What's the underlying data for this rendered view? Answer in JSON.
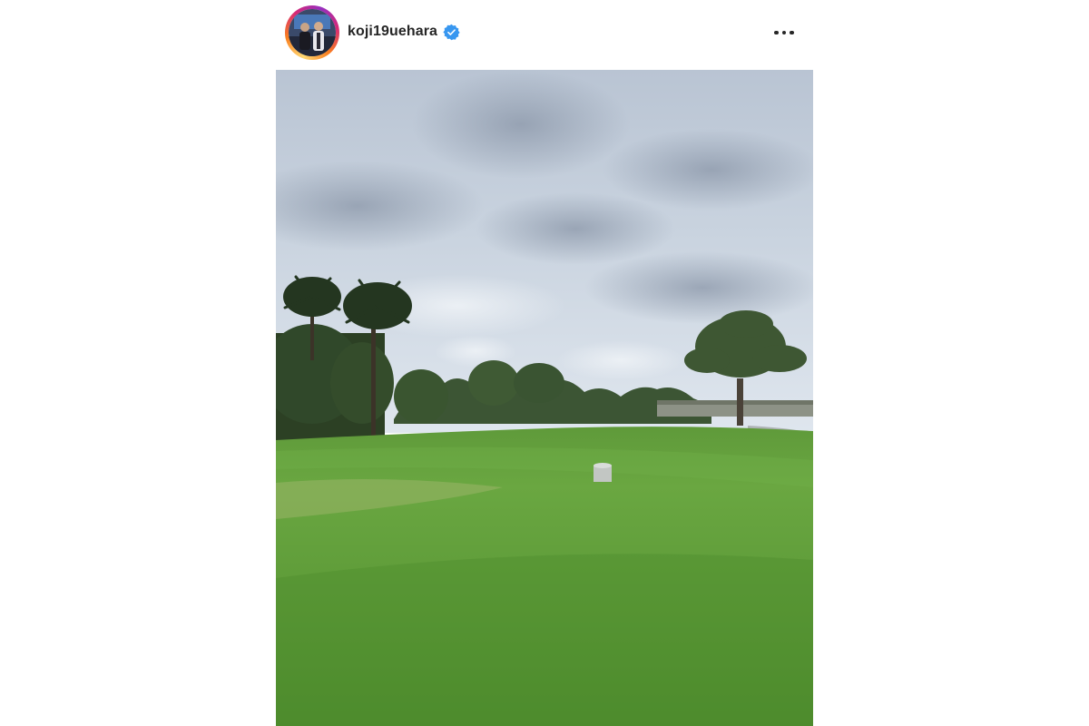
{
  "post": {
    "username": "koji19uehara",
    "verified": true,
    "avatar_icon": "profile-avatar",
    "verified_icon": "verified-badge-icon",
    "more_icon": "more-options-icon",
    "photo_subject": "golf-course-photo"
  },
  "colors": {
    "verified_badge": "#3897f0",
    "text_primary": "#262626",
    "ring_gradient": [
      "#feda75",
      "#fa7e1e",
      "#d62976",
      "#962fbf"
    ]
  }
}
